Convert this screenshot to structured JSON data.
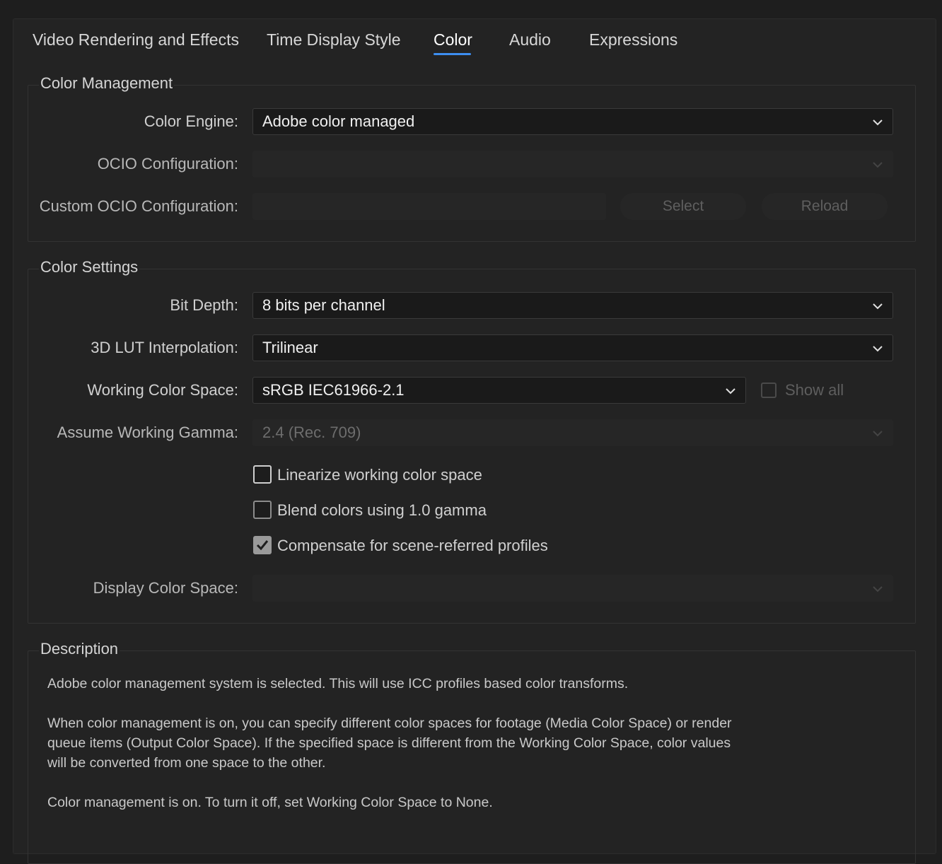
{
  "tabs": [
    {
      "label": "Video Rendering and Effects",
      "active": false
    },
    {
      "label": "Time Display Style",
      "active": false
    },
    {
      "label": "Color",
      "active": true
    },
    {
      "label": "Audio",
      "active": false
    },
    {
      "label": "Expressions",
      "active": false
    }
  ],
  "color_management": {
    "title": "Color Management",
    "color_engine_label": "Color Engine:",
    "color_engine_value": "Adobe color managed",
    "ocio_config_label": "OCIO Configuration:",
    "ocio_config_value": "",
    "custom_ocio_label": "Custom OCIO Configuration:",
    "custom_ocio_value": "",
    "select_button": "Select",
    "reload_button": "Reload"
  },
  "color_settings": {
    "title": "Color Settings",
    "bit_depth_label": "Bit Depth:",
    "bit_depth_value": "8 bits per channel",
    "lut_label": "3D LUT Interpolation:",
    "lut_value": "Trilinear",
    "working_space_label": "Working Color Space:",
    "working_space_value": "sRGB IEC61966-2.1",
    "show_all_label": "Show all",
    "show_all_checked": false,
    "gamma_label": "Assume Working Gamma:",
    "gamma_value": "2.4 (Rec. 709)",
    "linearize_label": "Linearize working color space",
    "linearize_checked": false,
    "blend_label": "Blend colors using 1.0 gamma",
    "blend_checked": false,
    "compensate_label": "Compensate for scene-referred profiles",
    "compensate_checked": true,
    "display_space_label": "Display Color Space:",
    "display_space_value": ""
  },
  "description": {
    "title": "Description",
    "line1": "Adobe color management system is selected. This will use ICC profiles based color transforms.",
    "para2_line1": "When color management is on, you can specify different color spaces for footage (Media Color Space) or render",
    "para2_line2": "queue items (Output Color Space). If the specified space is different from the Working Color Space, color values",
    "para2_line3": "will be converted from one space to the other.",
    "line3": "Color management is on. To turn it off, set Working Color Space to None."
  },
  "colors": {
    "accent": "#3d8ef0",
    "background": "#232323"
  }
}
